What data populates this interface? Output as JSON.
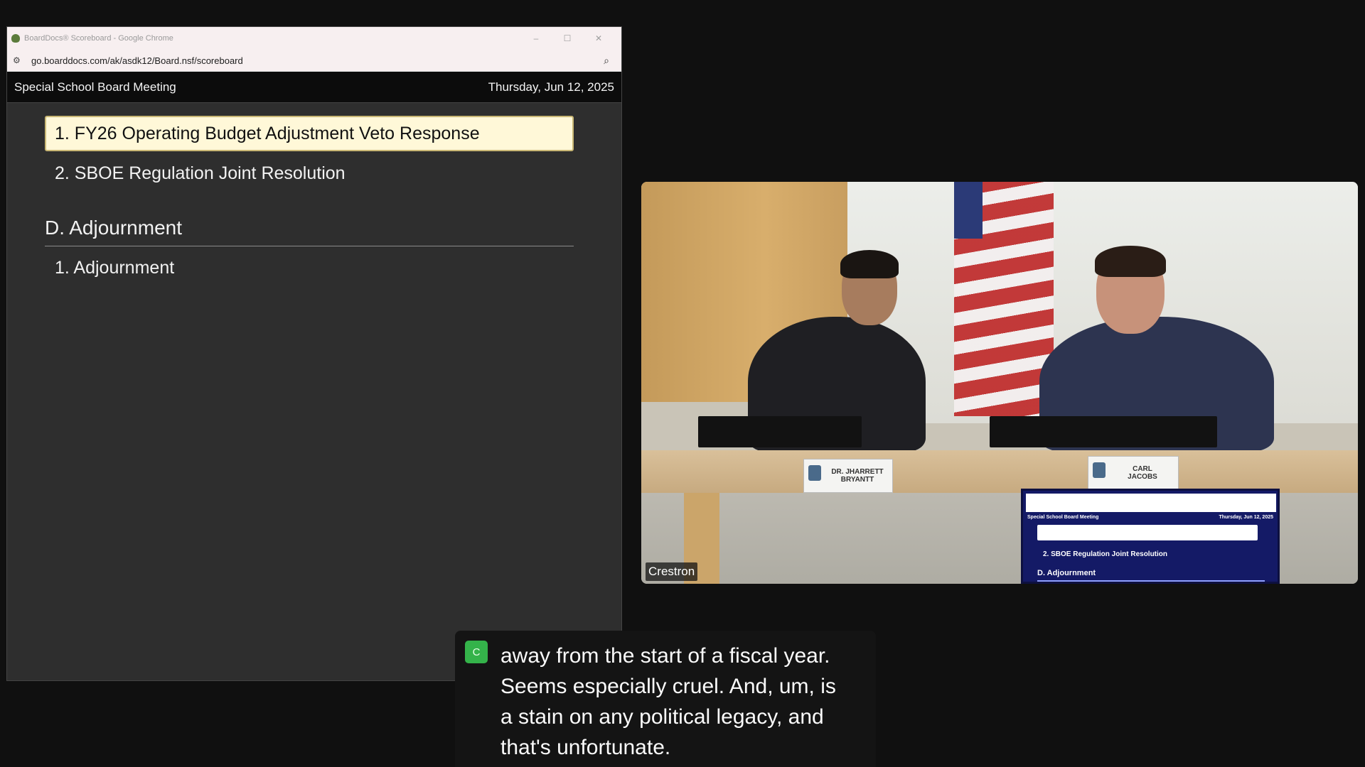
{
  "browser": {
    "window_title": "BoardDocs® Scoreboard - Google Chrome",
    "url": "go.boarddocs.com/ak/asdk12/Board.nsf/scoreboard",
    "controls": {
      "minimize": "–",
      "maximize": "☐",
      "close": "✕"
    },
    "site_info_icon": "tune-icon",
    "zoom_icon": "zoom-icon"
  },
  "scoreboard": {
    "meeting_title": "Special School Board Meeting",
    "date": "Thursday, Jun 12, 2025",
    "current_item": "1. FY26 Operating Budget Adjustment Veto Response",
    "items_before_section": [
      "2. SBOE Regulation Joint Resolution"
    ],
    "section": "D. Adjournment",
    "section_items": [
      "1. Adjournment"
    ]
  },
  "video": {
    "source_label": "Crestron",
    "nameplates": [
      {
        "line1": "DR. JHARRETT",
        "line2": "BRYANTT"
      },
      {
        "line1": "CARL",
        "line2": "JACOBS"
      }
    ],
    "monitor_screen": {
      "title": "Special School Board Meeting",
      "date": "Thursday, Jun 12, 2025",
      "item": "2. SBOE Regulation Joint Resolution",
      "section": "D. Adjournment"
    }
  },
  "captions": {
    "badge": "C",
    "lines": [
      "away from the start of a fiscal year.",
      "Seems especially cruel. And, um, is",
      "a stain on any political legacy, and",
      "that's unfortunate."
    ]
  },
  "colors": {
    "current_item_bg": "#fff8d8",
    "caption_badge": "#34b34a",
    "page_bg": "#2e2e2e"
  }
}
